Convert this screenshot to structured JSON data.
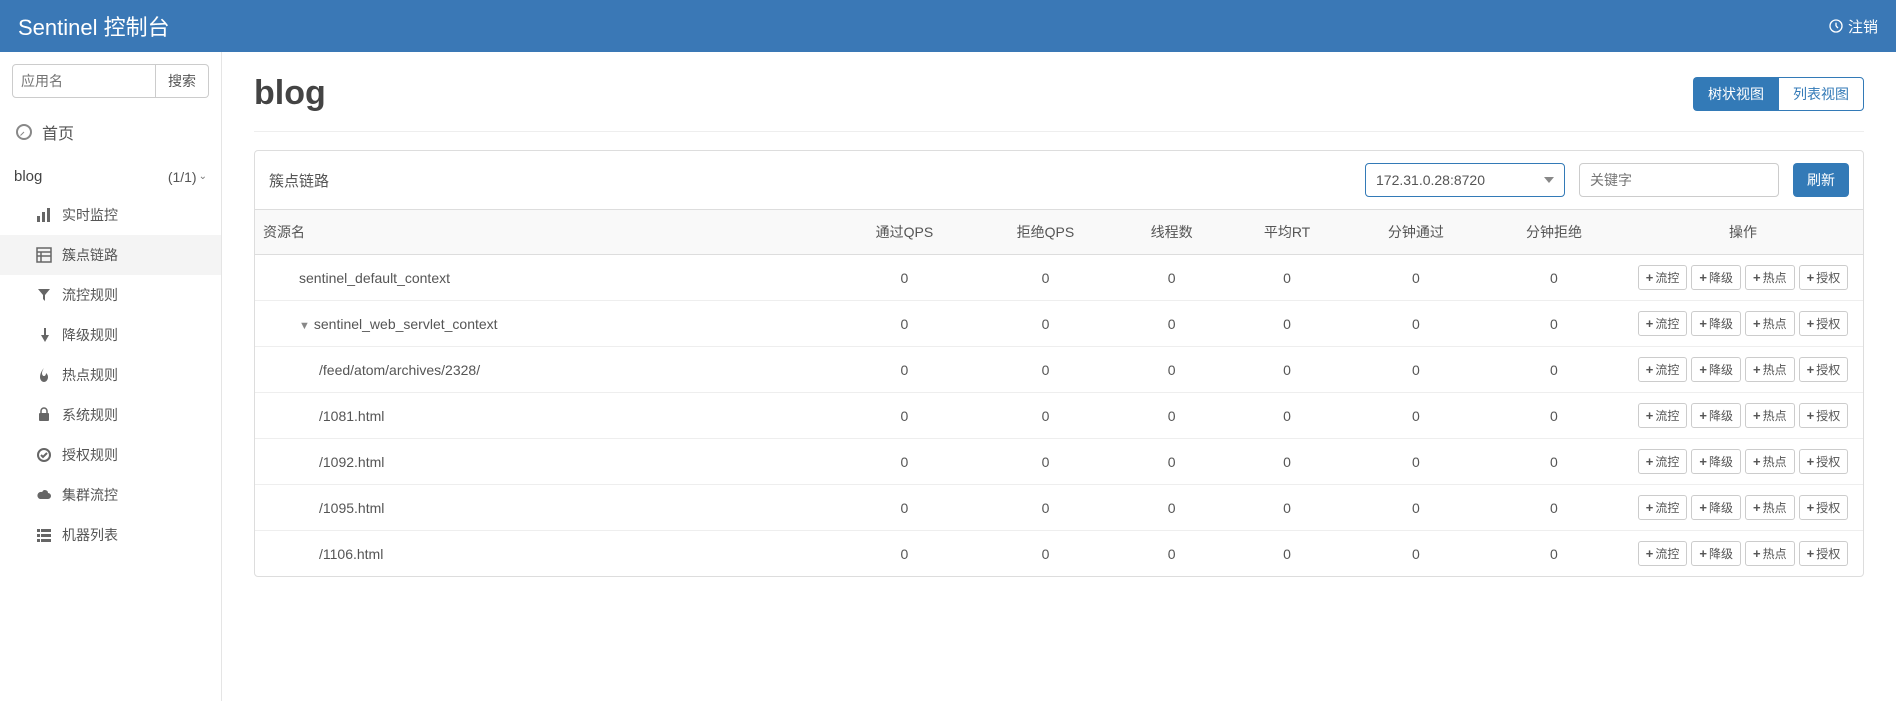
{
  "header": {
    "title": "Sentinel 控制台",
    "logout": "注销"
  },
  "sidebar": {
    "search": {
      "placeholder": "应用名",
      "button": "搜索"
    },
    "home": "首页",
    "app": {
      "name": "blog",
      "count": "(1/1)"
    },
    "menu": [
      {
        "key": "realtime",
        "label": "实时监控"
      },
      {
        "key": "cluster-point",
        "label": "簇点链路"
      },
      {
        "key": "flow-rule",
        "label": "流控规则"
      },
      {
        "key": "degrade-rule",
        "label": "降级规则"
      },
      {
        "key": "hotspot-rule",
        "label": "热点规则"
      },
      {
        "key": "system-rule",
        "label": "系统规则"
      },
      {
        "key": "auth-rule",
        "label": "授权规则"
      },
      {
        "key": "cluster-flow",
        "label": "集群流控"
      },
      {
        "key": "machine-list",
        "label": "机器列表"
      }
    ]
  },
  "page": {
    "title": "blog",
    "view_tree": "树状视图",
    "view_list": "列表视图"
  },
  "panel": {
    "title": "簇点链路",
    "machine_selected": "172.31.0.28:8720",
    "keyword_placeholder": "关键字",
    "refresh": "刷新"
  },
  "columns": {
    "resource": "资源名",
    "pass_qps": "通过QPS",
    "block_qps": "拒绝QPS",
    "threads": "线程数",
    "avg_rt": "平均RT",
    "min_pass": "分钟通过",
    "min_block": "分钟拒绝",
    "ops": "操作"
  },
  "ops": {
    "flow": "流控",
    "degrade": "降级",
    "hotspot": "热点",
    "auth": "授权"
  },
  "rows": [
    {
      "name": "sentinel_default_context",
      "indent": 1,
      "toggle": "",
      "pass": 0,
      "block": 0,
      "threads": 0,
      "rt": 0,
      "mp": 0,
      "mb": 0
    },
    {
      "name": "sentinel_web_servlet_context",
      "indent": 1,
      "toggle": "▼",
      "pass": 0,
      "block": 0,
      "threads": 0,
      "rt": 0,
      "mp": 0,
      "mb": 0
    },
    {
      "name": "/feed/atom/archives/2328/",
      "indent": 2,
      "toggle": "",
      "pass": 0,
      "block": 0,
      "threads": 0,
      "rt": 0,
      "mp": 0,
      "mb": 0
    },
    {
      "name": "/1081.html",
      "indent": 2,
      "toggle": "",
      "pass": 0,
      "block": 0,
      "threads": 0,
      "rt": 0,
      "mp": 0,
      "mb": 0
    },
    {
      "name": "/1092.html",
      "indent": 2,
      "toggle": "",
      "pass": 0,
      "block": 0,
      "threads": 0,
      "rt": 0,
      "mp": 0,
      "mb": 0
    },
    {
      "name": "/1095.html",
      "indent": 2,
      "toggle": "",
      "pass": 0,
      "block": 0,
      "threads": 0,
      "rt": 0,
      "mp": 0,
      "mb": 0
    },
    {
      "name": "/1106.html",
      "indent": 2,
      "toggle": "",
      "pass": 0,
      "block": 0,
      "threads": 0,
      "rt": 0,
      "mp": 0,
      "mb": 0
    }
  ]
}
